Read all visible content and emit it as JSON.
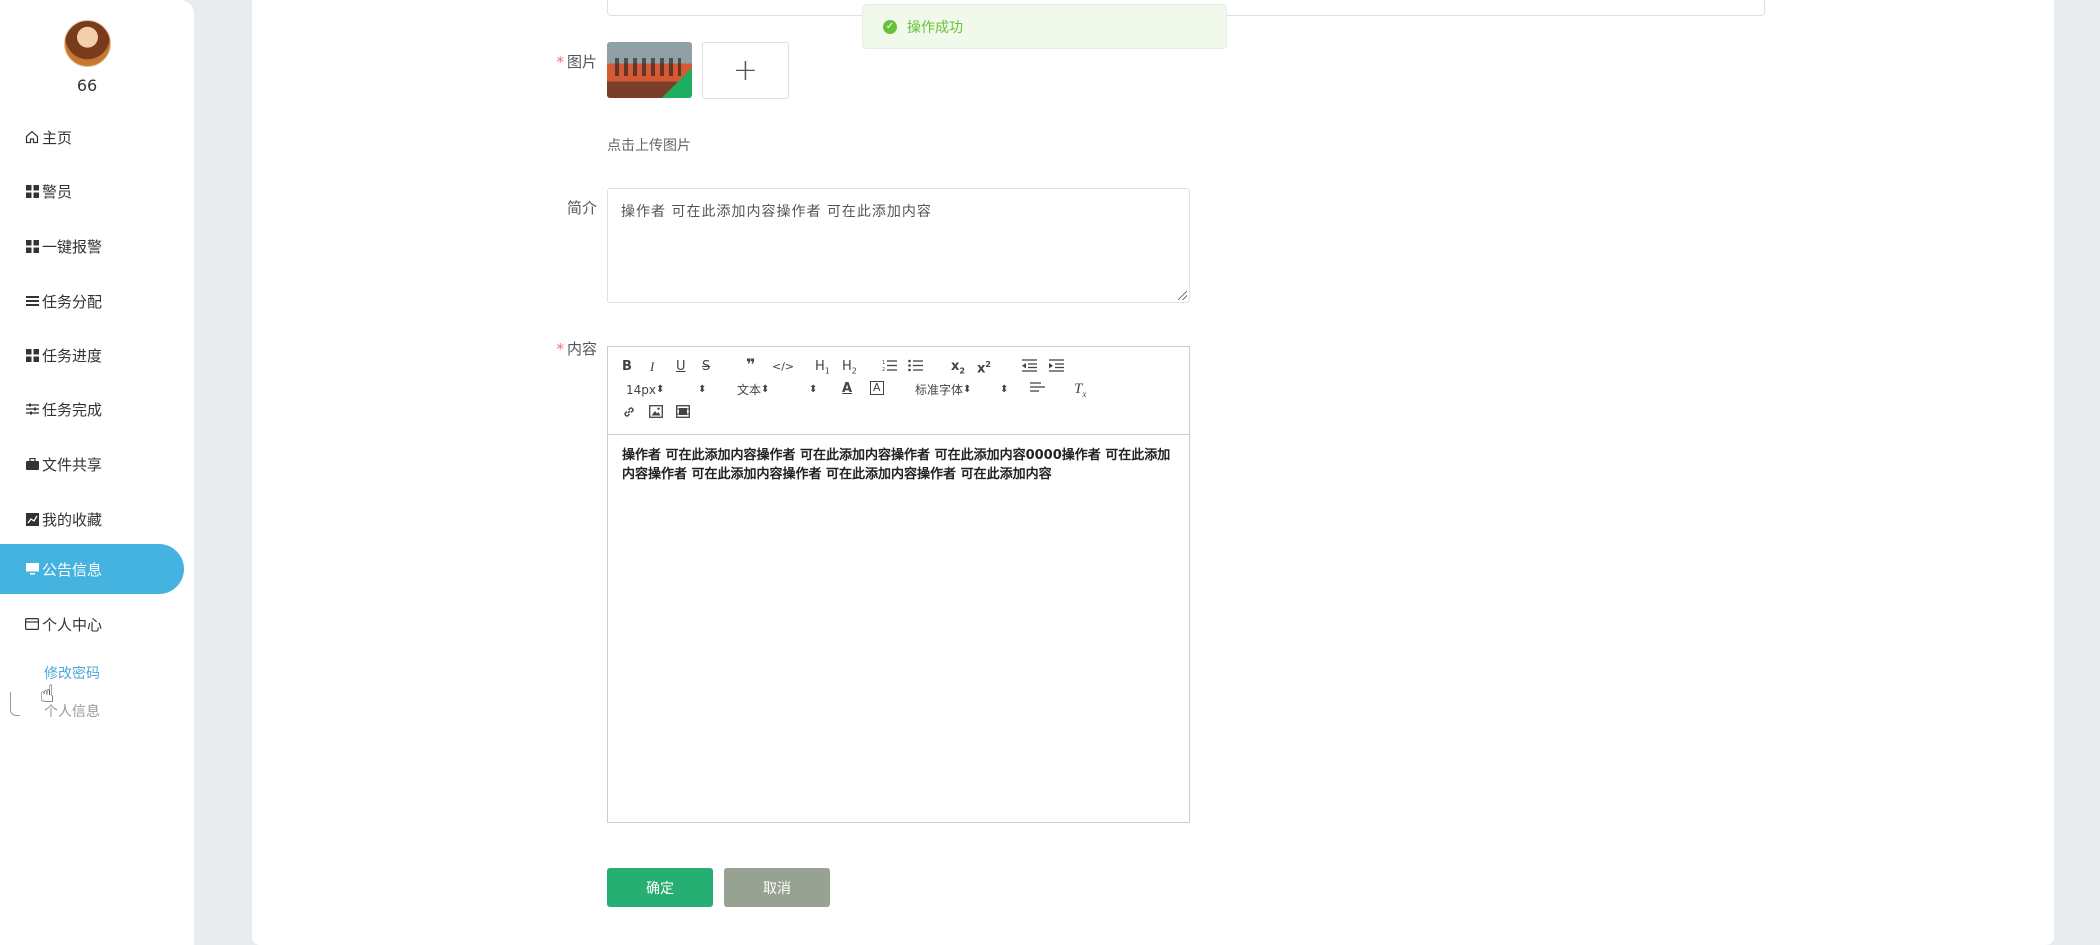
{
  "sidebar": {
    "username": "66",
    "items": [
      {
        "label": "主页",
        "icon": "home-icon"
      },
      {
        "label": "警员",
        "icon": "grid-icon"
      },
      {
        "label": "一键报警",
        "icon": "grid-icon"
      },
      {
        "label": "任务分配",
        "icon": "list-icon"
      },
      {
        "label": "任务进度",
        "icon": "grid-icon"
      },
      {
        "label": "任务完成",
        "icon": "sliders-icon"
      },
      {
        "label": "文件共享",
        "icon": "briefcase-icon"
      },
      {
        "label": "我的收藏",
        "icon": "chart-icon"
      },
      {
        "label": "公告信息",
        "icon": "monitor-icon"
      },
      {
        "label": "个人中心",
        "icon": "card-icon"
      }
    ],
    "submenu": {
      "change_password": "修改密码",
      "personal_info": "个人信息"
    }
  },
  "form": {
    "image_label": "图片",
    "upload_hint": "点击上传图片",
    "intro_label": "简介",
    "intro_value": "操作者 可在此添加内容操作者 可在此添加内容",
    "content_label": "内容",
    "content_value": "操作者 可在此添加内容操作者 可在此添加内容操作者 可在此添加内容0000操作者 可在此添加内容操作者 可在此添加内容操作者 可在此添加内容操作者 可在此添加内容"
  },
  "editor_toolbar": {
    "font_size": "14px",
    "format": "文本",
    "font_family": "标准字体"
  },
  "buttons": {
    "confirm": "确定",
    "cancel": "取消"
  },
  "toast": {
    "message": "操作成功"
  },
  "colors": {
    "active_menu": "#45b3e0",
    "confirm_button": "#27ae72",
    "cancel_button": "#98a293",
    "success": "#67c23a"
  }
}
